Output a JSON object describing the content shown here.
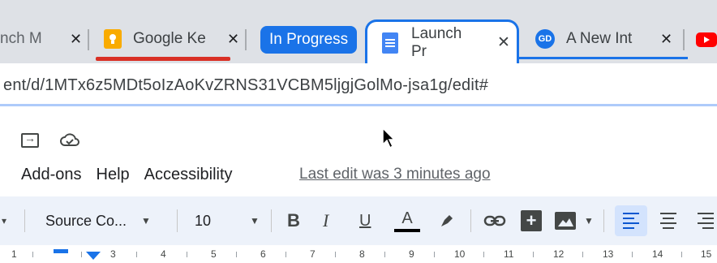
{
  "browser": {
    "tabs": [
      {
        "title": "nch M",
        "close": "✕"
      },
      {
        "title": "Google Ke",
        "close": "✕"
      },
      {
        "title": "Launch Pr",
        "close": "✕"
      },
      {
        "title": "A New Int",
        "close": "✕"
      }
    ],
    "group_label": "In Progress",
    "gd_badge": "GD",
    "url": "ent/d/1MTx6z5MDt5oIzAoKvZRNS31VCBM5ljgjGolMo-jsa1g/edit#"
  },
  "menu": {
    "items": [
      "Add-ons",
      "Help",
      "Accessibility"
    ],
    "last_edit": "Last edit was 3 minutes ago"
  },
  "toolbar": {
    "font": "Source Co...",
    "font_size": "10",
    "bold": "B",
    "italic": "I",
    "underline": "U",
    "text_color": "A",
    "add_comment": "+"
  },
  "ruler": {
    "numbers": [
      "1",
      "3",
      "4",
      "5",
      "6",
      "7",
      "8",
      "9",
      "10",
      "11",
      "12",
      "13",
      "14",
      "15"
    ]
  },
  "colors": {
    "accent": "#1a73e8",
    "group_label_bg": "#1a73e8",
    "toolbar_bg": "#edf2fa",
    "tabstrip_bg": "#dee1e6",
    "keep_icon": "#f9ab00",
    "recording_bar": "#d93025"
  }
}
